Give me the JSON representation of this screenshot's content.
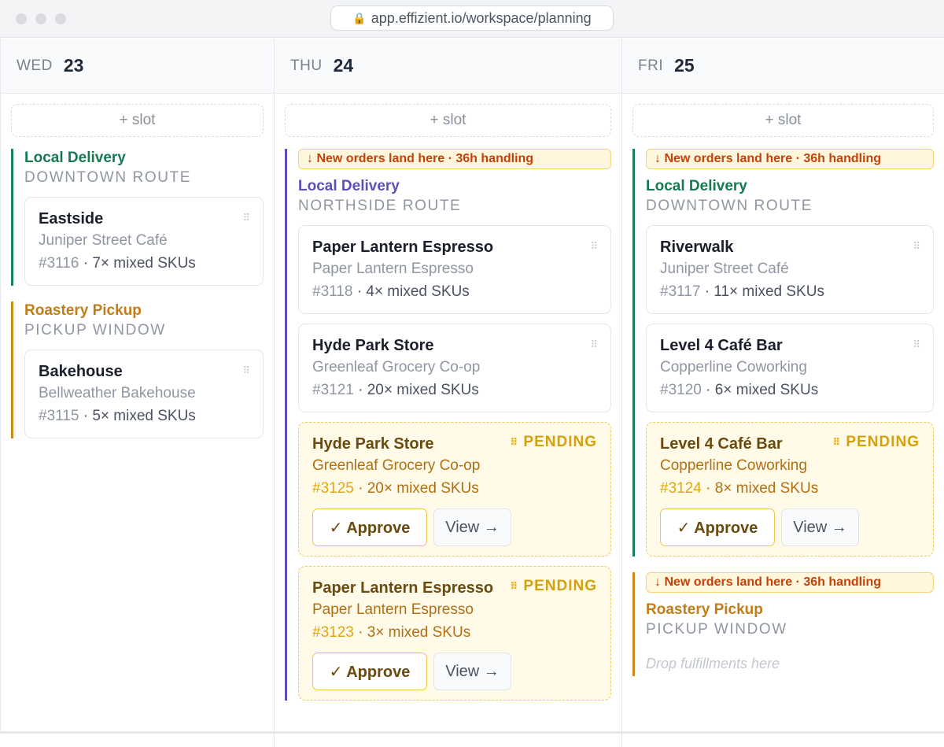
{
  "browser": {
    "url": "app.effizient.io/workspace/planning"
  },
  "slot_label": "+ slot",
  "columns": [
    {
      "dow": "WED",
      "day": "23",
      "groups": [
        {
          "title": "Local Delivery",
          "subtitle": "DOWNTOWN ROUTE",
          "cards": [
            {
              "name": "Eastside",
              "customer": "Juniper Street Café",
              "order": "#3116",
              "items": "· 7× mixed SKUs"
            }
          ]
        },
        {
          "title": "Roastery Pickup",
          "subtitle": "PICKUP WINDOW",
          "cards": [
            {
              "name": "Bakehouse",
              "customer": "Bellweather Bakehouse",
              "order": "#3115",
              "items": "· 5× mixed SKUs"
            }
          ]
        }
      ]
    },
    {
      "dow": "THU",
      "day": "24",
      "banner": "↓ New orders land here · 36h handling",
      "groups": [
        {
          "title": "Local Delivery",
          "subtitle": "NORTHSIDE ROUTE",
          "cards": [
            {
              "name": "Paper Lantern Espresso",
              "customer": "Paper Lantern Espresso",
              "order": "#3118",
              "items": "· 4× mixed SKUs"
            },
            {
              "name": "Hyde Park Store",
              "customer": "Greenleaf Grocery Co-op",
              "order": "#3121",
              "items": "· 20× mixed SKUs"
            },
            {
              "name": "Hyde Park Store",
              "customer": "Greenleaf Grocery Co-op",
              "order": "#3125",
              "items": "· 20× mixed SKUs",
              "status": "PENDING"
            },
            {
              "name": "Paper Lantern Espresso",
              "customer": "Paper Lantern Espresso",
              "order": "#3123",
              "items": "· 3× mixed SKUs",
              "status": "PENDING"
            }
          ]
        }
      ]
    },
    {
      "dow": "FRI",
      "day": "25",
      "groups": [
        {
          "banner": "↓ New orders land here · 36h handling",
          "title": "Local Delivery",
          "subtitle": "DOWNTOWN ROUTE",
          "cards": [
            {
              "name": "Riverwalk",
              "customer": "Juniper Street Café",
              "order": "#3117",
              "items": "· 11× mixed SKUs"
            },
            {
              "name": "Level 4 Café Bar",
              "customer": "Copperline Coworking",
              "order": "#3120",
              "items": "· 6× mixed SKUs"
            },
            {
              "name": "Level 4 Café Bar",
              "customer": "Copperline Coworking",
              "order": "#3124",
              "items": "· 8× mixed SKUs",
              "status": "PENDING"
            }
          ]
        },
        {
          "banner": "↓ New orders land here · 36h handling",
          "title": "Roastery Pickup",
          "subtitle": "PICKUP WINDOW",
          "empty": "Drop fulfillments here"
        }
      ]
    }
  ],
  "actions": {
    "approve": "✓ Approve",
    "view": "View →"
  },
  "colors": {
    "delivery": "#16845a",
    "pickup": "#cf8a1e",
    "northside": "#5b4fb8",
    "pending": "#d4a00c"
  }
}
